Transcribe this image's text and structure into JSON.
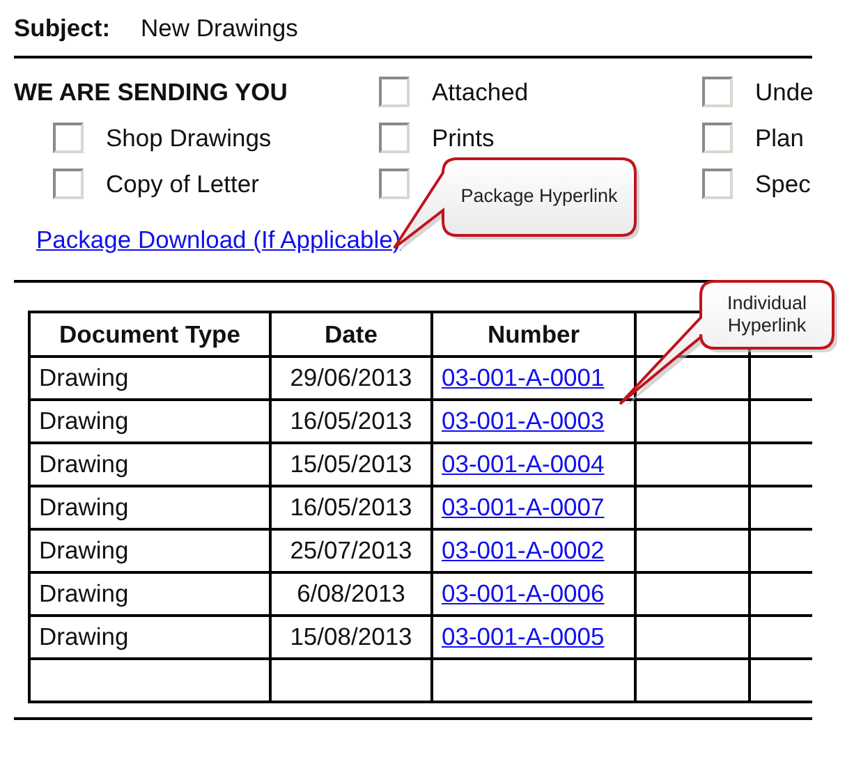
{
  "subject": {
    "label": "Subject:",
    "value": "New Drawings"
  },
  "sending": {
    "heading": "WE ARE SENDING YOU",
    "options": [
      {
        "label": "Attached",
        "checked": false
      },
      {
        "label": "Unde",
        "checked": false
      },
      {
        "label": "Shop Drawings",
        "checked": false
      },
      {
        "label": "Prints",
        "checked": false
      },
      {
        "label": "Plan",
        "checked": false
      },
      {
        "label": "Copy of Letter",
        "checked": false
      },
      {
        "checked": false
      },
      {
        "label": "Spec",
        "checked": false
      }
    ]
  },
  "package_link": "Package Download (If Applicable)",
  "table": {
    "columns": [
      "Document Type",
      "Date",
      "Number"
    ],
    "rows": [
      {
        "kind": "entry",
        "document_type": "Drawing",
        "date": "29/06/2013",
        "number": "03-001-A-0001"
      },
      {
        "kind": "entry",
        "document_type": "Drawing",
        "date": "16/05/2013",
        "number": "03-001-A-0003"
      },
      {
        "kind": "entry",
        "document_type": "Drawing",
        "date": "15/05/2013",
        "number": "03-001-A-0004"
      },
      {
        "kind": "entry",
        "document_type": "Drawing",
        "date": "16/05/2013",
        "number": "03-001-A-0007"
      },
      {
        "kind": "entry",
        "document_type": "Drawing",
        "date": "25/07/2013",
        "number": "03-001-A-0002"
      },
      {
        "kind": "entry",
        "document_type": "Drawing",
        "date": "6/08/2013",
        "number": "03-001-A-0006"
      },
      {
        "kind": "entry",
        "document_type": "Drawing",
        "date": "15/08/2013",
        "number": "03-001-A-0005"
      },
      {
        "kind": "empty"
      }
    ]
  },
  "callouts": [
    {
      "text": "Package Hyperlink"
    },
    {
      "text": "Individual Hyperlink"
    }
  ]
}
